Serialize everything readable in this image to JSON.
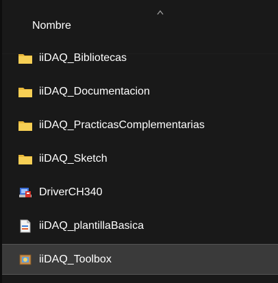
{
  "header": {
    "column_label": "Nombre",
    "sort_icon": "chevron-up-icon"
  },
  "colors": {
    "background": "#191919",
    "selected_row": "#3a3a3a",
    "folder": "#f2c84b"
  },
  "items": [
    {
      "name": "iiDAQ_Bibliotecas",
      "icon": "folder-icon",
      "selected": false
    },
    {
      "name": "iiDAQ_Documentacion",
      "icon": "folder-icon",
      "selected": false
    },
    {
      "name": "iiDAQ_PracticasComplementarias",
      "icon": "folder-icon",
      "selected": false
    },
    {
      "name": "iiDAQ_Sketch",
      "icon": "folder-icon",
      "selected": false
    },
    {
      "name": "DriverCH340",
      "icon": "installer-icon",
      "selected": false
    },
    {
      "name": "iiDAQ_plantillaBasica",
      "icon": "document-icon",
      "selected": false
    },
    {
      "name": "iiDAQ_Toolbox",
      "icon": "toolbox-package-icon",
      "selected": true
    }
  ]
}
